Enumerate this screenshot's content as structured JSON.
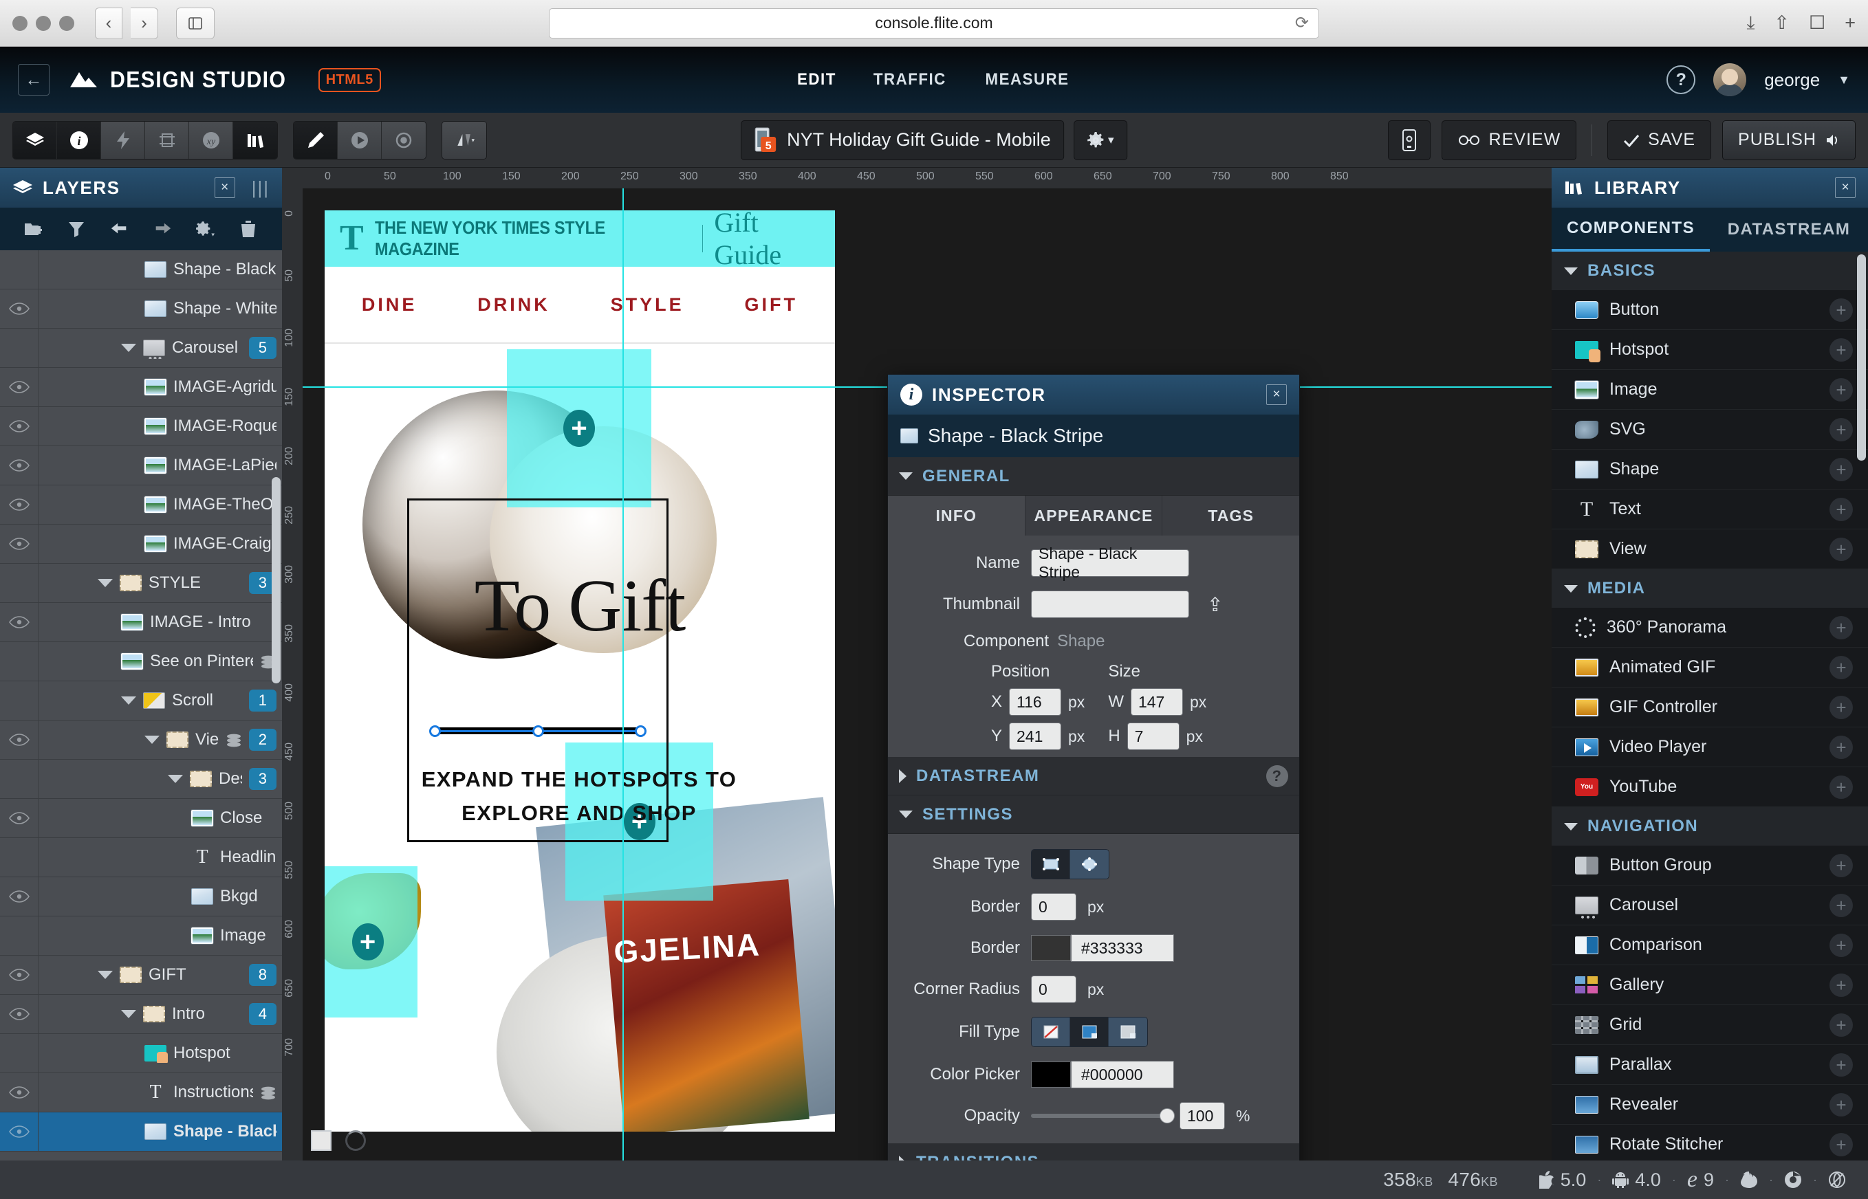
{
  "browser": {
    "url": "console.flite.com",
    "reload_icon": "reload-icon",
    "back_icon": "back-chevron-icon",
    "forward_icon": "forward-chevron-icon",
    "sidebar_icon": "sidebar-toggle-icon",
    "download_icon": "download-icon",
    "share_icon": "share-icon",
    "tabs_icon": "tabs-icon",
    "new_tab_icon": "plus-icon"
  },
  "app_header": {
    "back_label": "←",
    "brand": "DESIGN STUDIO",
    "badge": "HTML5",
    "nav": [
      {
        "label": "EDIT",
        "active": true
      },
      {
        "label": "TRAFFIC",
        "active": false
      },
      {
        "label": "MEASURE",
        "active": false
      }
    ],
    "help_label": "?",
    "user": "george",
    "caret": "▼"
  },
  "toolbar": {
    "left_tools": [
      {
        "name": "layers-tool",
        "active": true
      },
      {
        "name": "inspector-tool",
        "active": true
      },
      {
        "name": "actions-tool",
        "active": false
      },
      {
        "name": "artboard-tool",
        "active": false
      },
      {
        "name": "variables-tool",
        "active": false
      },
      {
        "name": "library-tool",
        "active": true
      }
    ],
    "mid_tools": [
      {
        "name": "pen-tool",
        "active": true
      },
      {
        "name": "play-tool",
        "active": false
      },
      {
        "name": "preview-tool",
        "active": false
      }
    ],
    "align_tool": {
      "name": "align-tool",
      "caret": "▾"
    },
    "doc_title": "NYT Holiday Gift Guide - Mobile",
    "gear_label": "⚙",
    "gear_caret": "▾",
    "device_icon": "mobile-device-icon",
    "review_label": "REVIEW",
    "save_label": "SAVE",
    "publish_label": "PUBLISH"
  },
  "layers_panel": {
    "title": "LAYERS",
    "close": "×",
    "toolbar_icons": [
      "new-folder-icon",
      "filter-icon",
      "undo-icon",
      "redo-icon",
      "settings-icon",
      "trash-icon"
    ],
    "rows": [
      {
        "name": "Shape - Black Stripe",
        "icon": "shape",
        "indent": 4,
        "eye": false,
        "badge": "",
        "caret": false,
        "partial": true
      },
      {
        "name": "Shape - White",
        "icon": "shape",
        "indent": 4,
        "eye": true,
        "badge": "",
        "caret": false
      },
      {
        "name": "Carousel",
        "icon": "carousel",
        "indent": 3,
        "eye": false,
        "badge": "5",
        "caret": true
      },
      {
        "name": "IMAGE-Agriduler",
        "icon": "image",
        "indent": 4,
        "eye": true,
        "badge": "",
        "caret": false
      },
      {
        "name": "IMAGE-Roquefort",
        "icon": "image",
        "indent": 4,
        "eye": true,
        "badge": "",
        "caret": false
      },
      {
        "name": "IMAGE-LaPiedra",
        "icon": "image",
        "indent": 4,
        "eye": true,
        "badge": "",
        "caret": false
      },
      {
        "name": "IMAGE-TheOldest",
        "icon": "image",
        "indent": 4,
        "eye": true,
        "badge": "",
        "caret": false
      },
      {
        "name": "IMAGE-CraigClaiborne",
        "icon": "image",
        "indent": 4,
        "eye": true,
        "badge": "",
        "caret": false
      },
      {
        "name": "STYLE",
        "icon": "view",
        "indent": 2,
        "eye": false,
        "badge": "3",
        "caret": true
      },
      {
        "name": "IMAGE - Intro",
        "icon": "image",
        "indent": 3,
        "eye": true,
        "badge": "",
        "caret": false
      },
      {
        "name": "See on Pinterest",
        "icon": "image",
        "indent": 3,
        "eye": false,
        "badge": "",
        "caret": false,
        "stack": true
      },
      {
        "name": "Scroll",
        "icon": "scroll",
        "indent": 3,
        "eye": false,
        "badge": "1",
        "caret": true
      },
      {
        "name": "View",
        "icon": "view",
        "indent": 4,
        "eye": true,
        "badge": "2",
        "caret": true,
        "stack": true
      },
      {
        "name": "Desc",
        "icon": "view",
        "indent": 5,
        "eye": false,
        "badge": "3",
        "caret": true
      },
      {
        "name": "Close",
        "icon": "image",
        "indent": 6,
        "eye": true,
        "badge": "",
        "caret": false
      },
      {
        "name": "Headline",
        "icon": "text",
        "indent": 6,
        "eye": false,
        "badge": "",
        "caret": false
      },
      {
        "name": "Bkgd",
        "icon": "shape",
        "indent": 6,
        "eye": true,
        "badge": "",
        "caret": false
      },
      {
        "name": "Image",
        "icon": "image",
        "indent": 6,
        "eye": false,
        "badge": "",
        "caret": false
      },
      {
        "name": "GIFT",
        "icon": "view",
        "indent": 2,
        "eye": true,
        "badge": "8",
        "caret": true
      },
      {
        "name": "Intro",
        "icon": "view",
        "indent": 3,
        "eye": true,
        "badge": "4",
        "caret": true
      },
      {
        "name": "Hotspot",
        "icon": "hotspot",
        "indent": 4,
        "eye": false,
        "badge": "",
        "caret": false
      },
      {
        "name": "Instructions",
        "icon": "text",
        "indent": 4,
        "eye": true,
        "badge": "",
        "caret": false,
        "stack": true
      },
      {
        "name": "Shape - Black",
        "icon": "shape",
        "indent": 4,
        "eye": true,
        "badge": "",
        "caret": false,
        "selected": true
      }
    ]
  },
  "canvas": {
    "ruler_h_ticks": [
      "0",
      "50",
      "100",
      "150",
      "200",
      "250",
      "300",
      "350",
      "400",
      "450",
      "500",
      "550",
      "600",
      "650",
      "700",
      "750",
      "800",
      "850"
    ],
    "ruler_v_ticks": [
      "0",
      "50",
      "100",
      "150",
      "200",
      "250",
      "300",
      "350",
      "400",
      "450",
      "500",
      "550",
      "600",
      "650",
      "700"
    ],
    "artboard": {
      "brand_mark": "T",
      "masthead": "THE NEW YORK TIMES STYLE MAGAZINE",
      "section": "Gift Guide",
      "nav": [
        "DINE",
        "DRINK",
        "STYLE",
        "GIFT"
      ],
      "headline": "To Gift",
      "instructions": "EXPAND THE HOTSPOTS TO EXPLORE AND SHOP",
      "book_text": "GJELINA",
      "hotspot_plus": "+"
    }
  },
  "inspector": {
    "title": "INSPECTOR",
    "close": "×",
    "selected_layer": "Shape - Black Stripe",
    "sections": {
      "general": "GENERAL",
      "datastream": "DATASTREAM",
      "settings": "SETTINGS",
      "transitions": "TRANSITIONS"
    },
    "tabs": [
      {
        "label": "INFO",
        "active": true
      },
      {
        "label": "APPEARANCE",
        "active": false
      },
      {
        "label": "TAGS",
        "active": false
      }
    ],
    "info": {
      "name_label": "Name",
      "name_value": "Shape - Black Stripe",
      "thumbnail_label": "Thumbnail",
      "thumbnail_value": "",
      "component_label": "Component",
      "component_value": "Shape",
      "position_label": "Position",
      "size_label": "Size",
      "x_label": "X",
      "x_value": "116",
      "y_label": "Y",
      "y_value": "241",
      "w_label": "W",
      "w_value": "147",
      "h_label": "H",
      "h_value": "7",
      "unit": "px"
    },
    "settings": {
      "shape_type_label": "Shape Type",
      "shape_type_options": [
        "rectangle",
        "ellipse"
      ],
      "border_width_label": "Border",
      "border_width_value": "0",
      "border_color_label": "Border",
      "border_color_value": "#333333",
      "corner_radius_label": "Corner Radius",
      "corner_radius_value": "0",
      "fill_type_label": "Fill Type",
      "fill_type_options": [
        "none",
        "solid",
        "gradient"
      ],
      "color_picker_label": "Color Picker",
      "color_picker_value": "#000000",
      "opacity_label": "Opacity",
      "opacity_value": "100",
      "percent": "%",
      "unit": "px"
    },
    "help_label": "?"
  },
  "library": {
    "title": "LIBRARY",
    "close": "×",
    "tabs": [
      {
        "label": "COMPONENTS",
        "active": true
      },
      {
        "label": "DATASTREAM",
        "active": false
      }
    ],
    "groups": [
      {
        "name": "BASICS",
        "items": [
          {
            "label": "Button",
            "icon": "ic-button"
          },
          {
            "label": "Hotspot",
            "icon": "ic-hotspot"
          },
          {
            "label": "Image",
            "icon": "ic-image"
          },
          {
            "label": "SVG",
            "icon": "ic-svg"
          },
          {
            "label": "Shape",
            "icon": "ic-shape"
          },
          {
            "label": "Text",
            "icon": "ic-text"
          },
          {
            "label": "View",
            "icon": "ic-view"
          }
        ]
      },
      {
        "name": "MEDIA",
        "items": [
          {
            "label": "360° Panorama",
            "icon": "ic-pano"
          },
          {
            "label": "Animated GIF",
            "icon": "ic-gif"
          },
          {
            "label": "GIF Controller",
            "icon": "ic-gifc"
          },
          {
            "label": "Video Player",
            "icon": "ic-video"
          },
          {
            "label": "YouTube",
            "icon": "ic-yt"
          }
        ]
      },
      {
        "name": "NAVIGATION",
        "items": [
          {
            "label": "Button Group",
            "icon": "ic-bgroup"
          },
          {
            "label": "Carousel",
            "icon": "ic-carousel"
          },
          {
            "label": "Comparison",
            "icon": "ic-comp"
          },
          {
            "label": "Gallery",
            "icon": "ic-gallery"
          },
          {
            "label": "Grid",
            "icon": "ic-grid"
          },
          {
            "label": "Parallax",
            "icon": "ic-parallax"
          },
          {
            "label": "Revealer",
            "icon": "ic-revealer"
          },
          {
            "label": "Rotate Stitcher",
            "icon": "ic-revealer"
          }
        ]
      }
    ],
    "add_symbol": "+"
  },
  "statusbar": {
    "size_initial": "358",
    "size_initial_unit": "KB",
    "size_total": "476",
    "size_total_unit": "KB",
    "browsers": [
      {
        "name": "apple-icon",
        "glyph": "",
        "version": "5.0"
      },
      {
        "name": "android-icon",
        "glyph": "●",
        "version": "4.0"
      },
      {
        "name": "ie-icon",
        "glyph": "e",
        "version": "9"
      },
      {
        "name": "firefox-icon",
        "glyph": "◐",
        "version": ""
      },
      {
        "name": "chrome-icon",
        "glyph": "◎",
        "version": ""
      },
      {
        "name": "opera-icon",
        "glyph": "⊘",
        "version": ""
      }
    ]
  },
  "colors": {
    "accent_blue": "#1d699f",
    "panel_header": "#1d3c55",
    "badge": "#1f7fae",
    "hotspot_cyan": "#50f4f4",
    "nyt_red": "#9d1a1f",
    "brand_orange": "#e8541f"
  }
}
